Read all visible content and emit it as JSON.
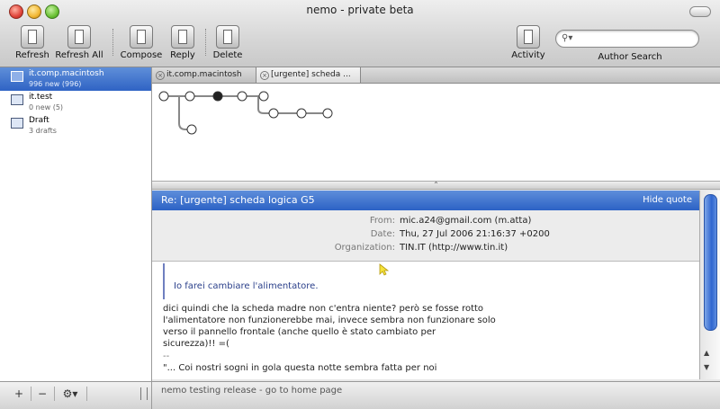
{
  "window": {
    "title": "nemo - private beta"
  },
  "toolbar": {
    "refresh": "Refresh",
    "refresh_all": "Refresh All",
    "compose": "Compose",
    "reply": "Reply",
    "delete": "Delete",
    "activity": "Activity",
    "search_placeholder": "",
    "search_caption": "Author Search"
  },
  "sidebar": {
    "items": [
      {
        "name": "it.comp.macintosh",
        "sub": "996 new (996)"
      },
      {
        "name": "it.test",
        "sub": "0 new (5)"
      },
      {
        "name": "Draft",
        "sub": "3 drafts"
      }
    ],
    "footer": {
      "add": "+",
      "remove": "−",
      "gear": "⚙▾"
    }
  },
  "tabs": [
    {
      "label": "it.comp.macintosh"
    },
    {
      "label": "[urgente] scheda ..."
    }
  ],
  "message": {
    "subject": "Re: [urgente] scheda logica G5",
    "hide_quote": "Hide quote",
    "from_label": "From:",
    "from": "mic.a24@gmail.com (m.atta)",
    "date_label": "Date:",
    "date": "Thu, 27 Jul 2006 21:16:37 +0200",
    "org_label": "Organization:",
    "org": "TIN.IT (http://www.tin.it)",
    "quoted": "Io farei cambiare l'alimentatore.",
    "body": [
      "dici quindi che la scheda madre non c'entra niente? però se fosse rotto",
      "l'alimentatore non funzionerebbe mai, invece sembra non funzionare solo",
      "verso il pannello frontale (anche quello è stato cambiato per",
      "sicurezza)!! =(",
      "--",
      "\"... Coi nostri sogni in gola questa notte sembra fatta per noi"
    ]
  },
  "status": {
    "text": "nemo testing release - go to home page"
  }
}
